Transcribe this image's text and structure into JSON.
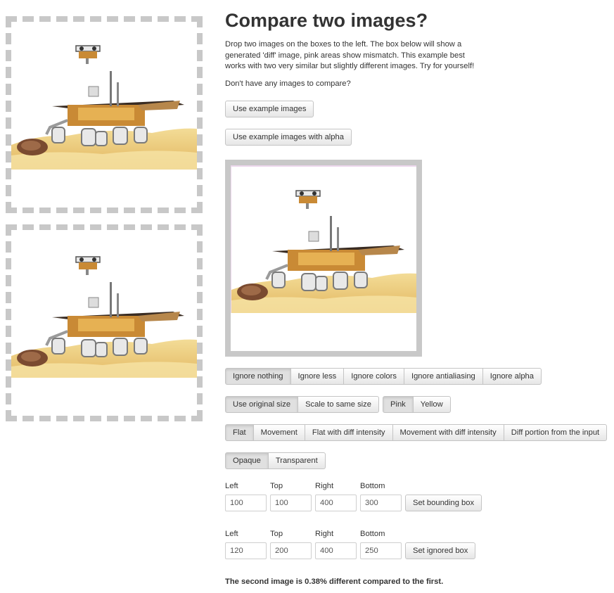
{
  "page": {
    "title": "Compare two images?",
    "intro": "Drop two images on the boxes to the left. The box below will show a generated 'diff' image, pink areas show mismatch. This example best works with two very similar but slightly different images. Try for yourself!",
    "no_images": "Don't have any images to compare?"
  },
  "buttons": {
    "use_example": "Use example images",
    "use_example_alpha": "Use example images with alpha"
  },
  "ignore_group": [
    "Ignore nothing",
    "Ignore less",
    "Ignore colors",
    "Ignore antialiasing",
    "Ignore alpha"
  ],
  "size_group": [
    "Use original size",
    "Scale to same size"
  ],
  "color_group": [
    "Pink",
    "Yellow"
  ],
  "mode_group": [
    "Flat",
    "Movement",
    "Flat with diff intensity",
    "Movement with diff intensity",
    "Diff portion from the input"
  ],
  "opacity_group": [
    "Opaque",
    "Transparent"
  ],
  "bounding": {
    "labels": [
      "Left",
      "Top",
      "Right",
      "Bottom"
    ],
    "values": [
      "100",
      "100",
      "400",
      "300"
    ],
    "button": "Set bounding box"
  },
  "ignored": {
    "labels": [
      "Left",
      "Top",
      "Right",
      "Bottom"
    ],
    "values": [
      "120",
      "200",
      "400",
      "250"
    ],
    "button": "Set ignored box"
  },
  "result": "The second image is 0.38% different compared to the first.",
  "colors": {
    "dropzone_border": "#c8c8c8",
    "sand": "#e8c878",
    "active_button": "#e0e0e0"
  }
}
